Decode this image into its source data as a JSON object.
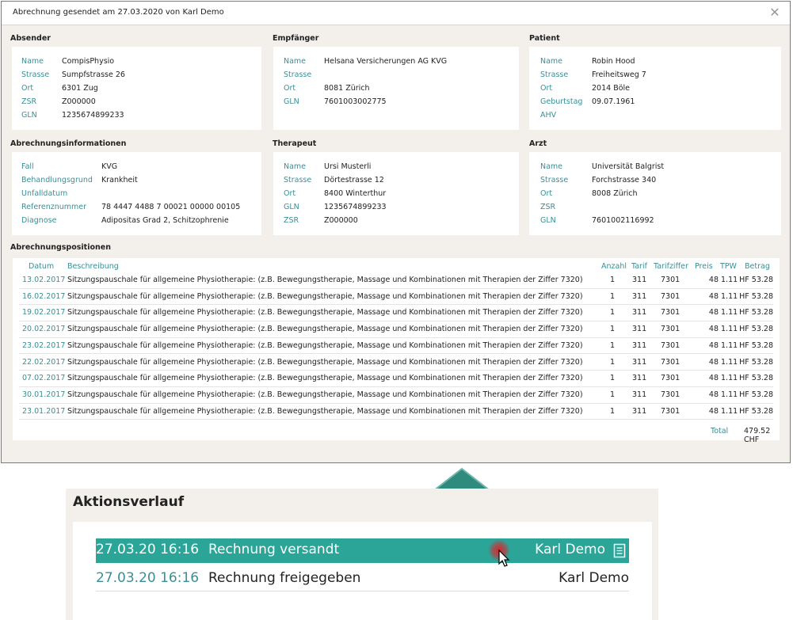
{
  "dialog": {
    "title": "Abrechnung gesendet am 27.03.2020 von Karl Demo",
    "close_label": "✕"
  },
  "sections": {
    "absender": {
      "title": "Absender",
      "fields": [
        {
          "k": "Name",
          "v": "CompisPhysio"
        },
        {
          "k": "Strasse",
          "v": "Sumpfstrasse 26"
        },
        {
          "k": "Ort",
          "v": "6301 Zug"
        },
        {
          "k": "ZSR",
          "v": "Z000000"
        },
        {
          "k": "GLN",
          "v": "1235674899233"
        }
      ]
    },
    "empfaenger": {
      "title": "Empfänger",
      "fields": [
        {
          "k": "Name",
          "v": "Helsana Versicherungen AG KVG"
        },
        {
          "k": "Strasse",
          "v": ""
        },
        {
          "k": "Ort",
          "v": "8081 Zürich"
        },
        {
          "k": "GLN",
          "v": "7601003002775"
        }
      ]
    },
    "patient": {
      "title": "Patient",
      "fields": [
        {
          "k": "Name",
          "v": "Robin Hood"
        },
        {
          "k": "Strasse",
          "v": "Freiheitsweg 7"
        },
        {
          "k": "Ort",
          "v": "2014 Böle"
        },
        {
          "k": "Geburtstag",
          "v": "09.07.1961"
        },
        {
          "k": "AHV",
          "v": ""
        }
      ]
    },
    "abrechnung": {
      "title": "Abrechnungsinformationen",
      "fields": [
        {
          "k": "Fall",
          "v": "KVG"
        },
        {
          "k": "Behandlungsgrund",
          "v": "Krankheit"
        },
        {
          "k": "Unfalldatum",
          "v": ""
        },
        {
          "k": "Referenznummer",
          "v": "78 4447 4488 7 00021 00000 00105"
        },
        {
          "k": "Diagnose",
          "v": "Adipositas Grad 2, Schitzophrenie"
        }
      ]
    },
    "therapeut": {
      "title": "Therapeut",
      "fields": [
        {
          "k": "Name",
          "v": "Ursi Musterli"
        },
        {
          "k": "Strasse",
          "v": "Dörtestrasse 12"
        },
        {
          "k": "Ort",
          "v": "8400 Winterthur"
        },
        {
          "k": "GLN",
          "v": "1235674899233"
        },
        {
          "k": "ZSR",
          "v": "Z000000"
        }
      ]
    },
    "arzt": {
      "title": "Arzt",
      "fields": [
        {
          "k": "Name",
          "v": "Universität Balgrist"
        },
        {
          "k": "Strasse",
          "v": "Forchstrasse 340"
        },
        {
          "k": "Ort",
          "v": "8008 Zürich"
        },
        {
          "k": "ZSR",
          "v": ""
        },
        {
          "k": "GLN",
          "v": "7601002116992"
        }
      ]
    }
  },
  "positions": {
    "title": "Abrechnungspositionen",
    "columns": {
      "datum": "Datum",
      "beschreibung": "Beschreibung",
      "anzahl": "Anzahl",
      "tarif": "Tarif",
      "tarifziffer": "Tarifziffer",
      "preis": "Preis",
      "tpw": "TPW",
      "betrag": "Betrag"
    },
    "rows": [
      {
        "datum": "13.02.2017",
        "beschreibung": "Sitzungspauschale für allgemeine Physiotherapie: (z.B. Bewegungstherapie, Massage und Kombinationen mit Therapien der Ziffer 7320)",
        "anzahl": "1",
        "tarif": "311",
        "tarifziffer": "7301",
        "preis": "48",
        "tpw": "1.11",
        "betrag": "53.28 CHF"
      },
      {
        "datum": "16.02.2017",
        "beschreibung": "Sitzungspauschale für allgemeine Physiotherapie: (z.B. Bewegungstherapie, Massage und Kombinationen mit Therapien der Ziffer 7320)",
        "anzahl": "1",
        "tarif": "311",
        "tarifziffer": "7301",
        "preis": "48",
        "tpw": "1.11",
        "betrag": "53.28 CHF"
      },
      {
        "datum": "19.02.2017",
        "beschreibung": "Sitzungspauschale für allgemeine Physiotherapie: (z.B. Bewegungstherapie, Massage und Kombinationen mit Therapien der Ziffer 7320)",
        "anzahl": "1",
        "tarif": "311",
        "tarifziffer": "7301",
        "preis": "48",
        "tpw": "1.11",
        "betrag": "53.28 CHF"
      },
      {
        "datum": "20.02.2017",
        "beschreibung": "Sitzungspauschale für allgemeine Physiotherapie: (z.B. Bewegungstherapie, Massage und Kombinationen mit Therapien der Ziffer 7320)",
        "anzahl": "1",
        "tarif": "311",
        "tarifziffer": "7301",
        "preis": "48",
        "tpw": "1.11",
        "betrag": "53.28 CHF"
      },
      {
        "datum": "23.02.2017",
        "beschreibung": "Sitzungspauschale für allgemeine Physiotherapie: (z.B. Bewegungstherapie, Massage und Kombinationen mit Therapien der Ziffer 7320)",
        "anzahl": "1",
        "tarif": "311",
        "tarifziffer": "7301",
        "preis": "48",
        "tpw": "1.11",
        "betrag": "53.28 CHF"
      },
      {
        "datum": "22.02.2017",
        "beschreibung": "Sitzungspauschale für allgemeine Physiotherapie: (z.B. Bewegungstherapie, Massage und Kombinationen mit Therapien der Ziffer 7320)",
        "anzahl": "1",
        "tarif": "311",
        "tarifziffer": "7301",
        "preis": "48",
        "tpw": "1.11",
        "betrag": "53.28 CHF"
      },
      {
        "datum": "07.02.2017",
        "beschreibung": "Sitzungspauschale für allgemeine Physiotherapie: (z.B. Bewegungstherapie, Massage und Kombinationen mit Therapien der Ziffer 7320)",
        "anzahl": "1",
        "tarif": "311",
        "tarifziffer": "7301",
        "preis": "48",
        "tpw": "1.11",
        "betrag": "53.28 CHF"
      },
      {
        "datum": "30.01.2017",
        "beschreibung": "Sitzungspauschale für allgemeine Physiotherapie: (z.B. Bewegungstherapie, Massage und Kombinationen mit Therapien der Ziffer 7320)",
        "anzahl": "1",
        "tarif": "311",
        "tarifziffer": "7301",
        "preis": "48",
        "tpw": "1.11",
        "betrag": "53.28 CHF"
      },
      {
        "datum": "23.01.2017",
        "beschreibung": "Sitzungspauschale für allgemeine Physiotherapie: (z.B. Bewegungstherapie, Massage und Kombinationen mit Therapien der Ziffer 7320)",
        "anzahl": "1",
        "tarif": "311",
        "tarifziffer": "7301",
        "preis": "48",
        "tpw": "1.11",
        "betrag": "53.28 CHF"
      }
    ],
    "total_label": "Total",
    "total_value": "479.52 CHF"
  },
  "history": {
    "title": "Aktionsverlauf",
    "entries": [
      {
        "timestamp": "27.03.20 16:16",
        "action": "Rechnung versandt",
        "user": "Karl Demo",
        "icon": "document-icon",
        "active": true
      },
      {
        "timestamp": "27.03.20 16:16",
        "action": "Rechnung freigegeben",
        "user": "Karl Demo",
        "active": false
      }
    ]
  },
  "colors": {
    "accent": "#3a8f96",
    "highlight": "#2aa598",
    "arrow": "#2e8b7e",
    "background": "#f3efeb"
  }
}
